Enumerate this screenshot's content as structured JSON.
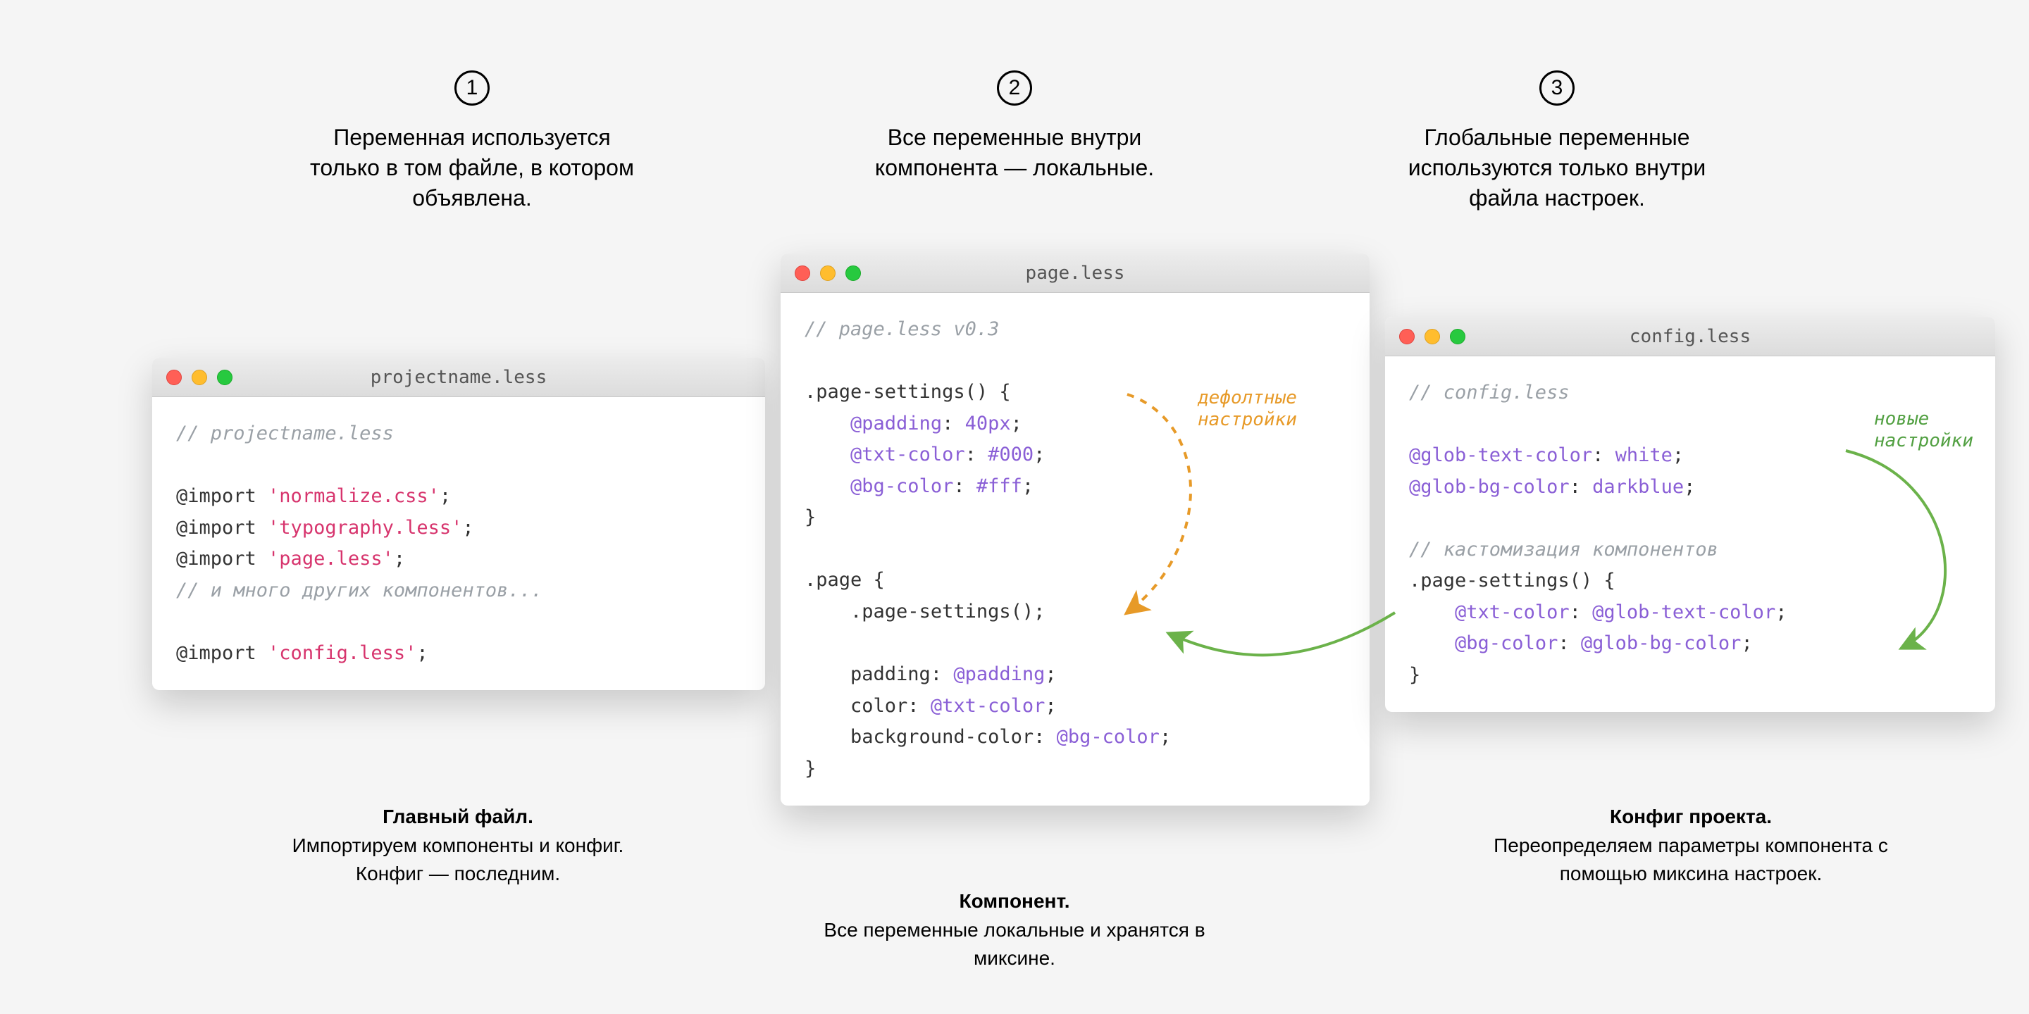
{
  "steps": [
    {
      "num": "1",
      "text": "Переменная используется только в том файле, в котором объявлена."
    },
    {
      "num": "2",
      "text": "Все переменные внутри компонента — локальные."
    },
    {
      "num": "3",
      "text": "Глобальные переменные используются только внутри файла настроек."
    }
  ],
  "windows": {
    "w1": {
      "title": "projectname.less",
      "lines": [
        {
          "type": "comment",
          "text": "// projectname.less"
        },
        {
          "type": "blank",
          "text": ""
        },
        {
          "type": "import",
          "kw": "@import ",
          "str": "'normalize.css'",
          "end": ";"
        },
        {
          "type": "import",
          "kw": "@import ",
          "str": "'typography.less'",
          "end": ";"
        },
        {
          "type": "import",
          "kw": "@import ",
          "str": "'page.less'",
          "end": ";"
        },
        {
          "type": "comment",
          "text": "// и много других компонентов..."
        },
        {
          "type": "blank",
          "text": ""
        },
        {
          "type": "import",
          "kw": "@import ",
          "str": "'config.less'",
          "end": ";"
        }
      ]
    },
    "w2": {
      "title": "page.less",
      "lines": [
        {
          "type": "comment",
          "text": "// page.less v0.3"
        },
        {
          "type": "blank",
          "text": ""
        },
        {
          "type": "sel",
          "text": ".page-settings() {"
        },
        {
          "type": "decl",
          "indent": "    ",
          "var": "@padding",
          "sep": ": ",
          "val": "40px",
          "end": ";"
        },
        {
          "type": "decl",
          "indent": "    ",
          "var": "@txt-color",
          "sep": ": ",
          "val": "#000",
          "end": ";"
        },
        {
          "type": "decl",
          "indent": "    ",
          "var": "@bg-color",
          "sep": ": ",
          "val": "#fff",
          "end": ";"
        },
        {
          "type": "sel",
          "text": "}"
        },
        {
          "type": "blank",
          "text": ""
        },
        {
          "type": "sel",
          "text": ".page {"
        },
        {
          "type": "mixin",
          "indent": "    ",
          "text": ".page-settings();"
        },
        {
          "type": "blank",
          "text": ""
        },
        {
          "type": "prop",
          "indent": "    ",
          "prop": "padding: ",
          "var": "@padding",
          "end": ";"
        },
        {
          "type": "prop",
          "indent": "    ",
          "prop": "color: ",
          "var": "@txt-color",
          "end": ";"
        },
        {
          "type": "prop",
          "indent": "    ",
          "prop": "background-color: ",
          "var": "@bg-color",
          "end": ";"
        },
        {
          "type": "sel",
          "text": "}"
        }
      ]
    },
    "w3": {
      "title": "config.less",
      "lines": [
        {
          "type": "comment",
          "text": "// config.less"
        },
        {
          "type": "blank",
          "text": ""
        },
        {
          "type": "decl",
          "indent": "",
          "var": "@glob-text-color",
          "sep": ": ",
          "val": "white",
          "end": ";"
        },
        {
          "type": "decl",
          "indent": "",
          "var": "@glob-bg-color",
          "sep": ": ",
          "val": "darkblue",
          "end": ";"
        },
        {
          "type": "blank",
          "text": ""
        },
        {
          "type": "comment",
          "text": "// кастомизация компонентов"
        },
        {
          "type": "sel",
          "text": ".page-settings() {"
        },
        {
          "type": "decl2",
          "indent": "    ",
          "var": "@txt-color",
          "sep": ": ",
          "val": "@glob-text-color",
          "end": ";"
        },
        {
          "type": "decl2",
          "indent": "    ",
          "var": "@bg-color",
          "sep": ": ",
          "val": "@glob-bg-color",
          "end": ";"
        },
        {
          "type": "sel",
          "text": "}"
        }
      ]
    }
  },
  "captions": {
    "c1": {
      "title": "Главный файл.",
      "body": "Импортируем компоненты и конфиг. Конфиг — последним."
    },
    "c2": {
      "title": "Компонент.",
      "body": "Все переменные локальные и хранятся в миксине."
    },
    "c3": {
      "title": "Конфиг проекта.",
      "body": "Переопределяем параметры компонента с помощью миксина настроек."
    }
  },
  "annotations": {
    "a1": "дефолтные\nнастройки",
    "a2": "новые\nнастройки"
  }
}
